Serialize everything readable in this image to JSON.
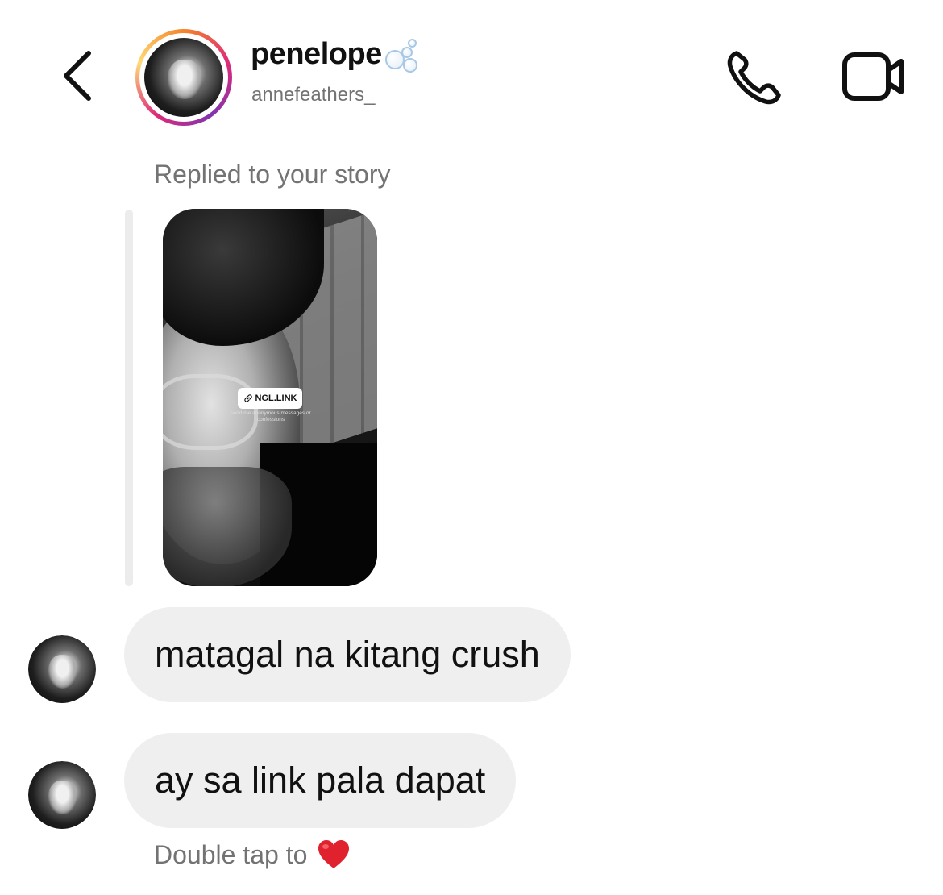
{
  "header": {
    "display_name": "penelope",
    "username": "annefeathers_",
    "icons": {
      "back": "chevron-left-icon",
      "name_decoration": "bubbles-icon",
      "call": "phone-icon",
      "video": "video-camera-icon"
    }
  },
  "thread": {
    "reply_context": "Replied to your story",
    "story": {
      "sticker_label": "NGL.LINK",
      "sticker_caption": "send me anonymous messages or confessions"
    },
    "messages": [
      {
        "text": "matagal na kitang crush"
      },
      {
        "text": "ay sa link pala dapat"
      }
    ],
    "double_tap_hint": "Double tap to",
    "reaction_icon": "heart-icon",
    "reaction_color": "#e0222f"
  }
}
